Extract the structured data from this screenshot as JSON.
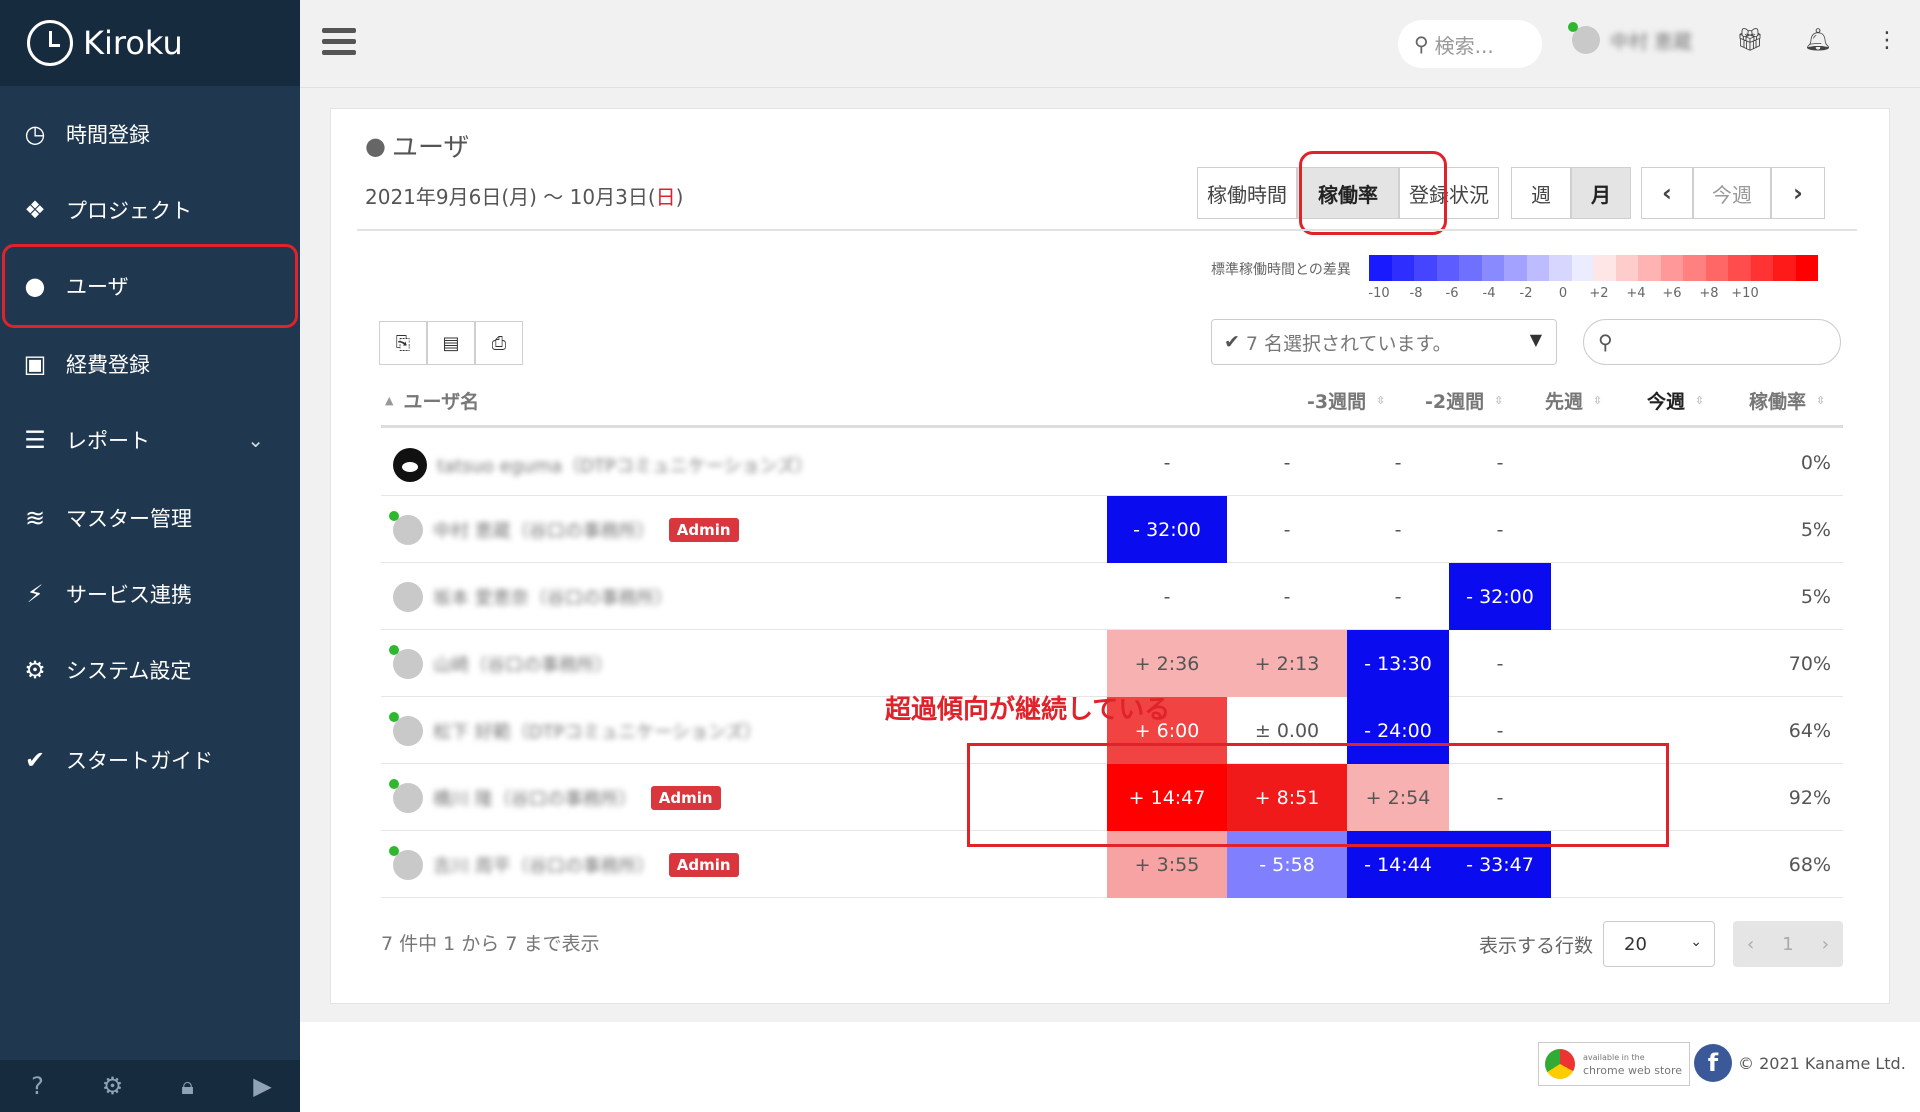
{
  "app": {
    "name": "Kiroku"
  },
  "sidebar": {
    "items": [
      {
        "label": "時間登録",
        "icon": "clock-icon"
      },
      {
        "label": "プロジェクト",
        "icon": "cubes-icon"
      },
      {
        "label": "ユーザ",
        "icon": "user-icon",
        "active": true
      },
      {
        "label": "経費登録",
        "icon": "train-icon"
      },
      {
        "label": "レポート",
        "icon": "list-icon",
        "has_submenu": true
      },
      {
        "label": "マスター管理",
        "icon": "database-icon"
      },
      {
        "label": "サービス連携",
        "icon": "plug-icon"
      },
      {
        "label": "システム設定",
        "icon": "gear-icon"
      },
      {
        "label": "スタートガイド",
        "icon": "check-icon"
      }
    ],
    "footer_icons": [
      "help-icon",
      "gear-icon",
      "lock-icon",
      "play-icon"
    ]
  },
  "topbar": {
    "search_placeholder": "検索...",
    "user_name": "中村 恵蔵"
  },
  "page": {
    "title": "ユーザ",
    "date_range_prefix": "2021年9月6日(月) ～ 10月3日(",
    "date_range_sun": "日",
    "date_range_suffix": ")",
    "view_tabs": [
      "稼働時間",
      "稼働率",
      "登録状況"
    ],
    "active_view": "稼働率",
    "period_tabs": [
      "週",
      "月"
    ],
    "active_period": "月",
    "this_week": "今週"
  },
  "legend": {
    "label": "標準稼働時間との差異",
    "ticks": [
      "-10",
      "-8",
      "-6",
      "-4",
      "-2",
      "0",
      "+2",
      "+4",
      "+6",
      "+8",
      "+10"
    ],
    "blue_scale": [
      "#1a1aff",
      "#2e2eff",
      "#4545ff",
      "#5c5cff",
      "#7070ff",
      "#8a8aff",
      "#a3a3ff",
      "#bcbcff",
      "#d6d6ff",
      "#ececff"
    ],
    "red_scale": [
      "#ffe6e6",
      "#ffcccc",
      "#ffb3b3",
      "#ff9999",
      "#ff8080",
      "#ff6666",
      "#ff4d4d",
      "#ff3333",
      "#ff1a1a",
      "#ff0000"
    ]
  },
  "filter": {
    "selected_text": "7 名選択されています。"
  },
  "table": {
    "headers": {
      "user": "ユーザ名",
      "w3": "-3週間",
      "w2": "-2週間",
      "w1": "先週",
      "w0": "今週",
      "rate": "稼働率"
    },
    "rows": [
      {
        "name": "tatsuo eguma（DTPコミュニケーションズ）",
        "admin": false,
        "online": false,
        "kumamon": true,
        "w3": "-",
        "w2": "-",
        "w1": "-",
        "w0": "-",
        "rate": "0%",
        "c3": "",
        "c2": "",
        "c1": "",
        "c0": ""
      },
      {
        "name": "中村 恵蔵（谷口の事務所）",
        "admin": true,
        "online": true,
        "w3": "- 32:00",
        "w2": "-",
        "w1": "-",
        "w0": "-",
        "rate": "5%",
        "c3": "#0b0bf0",
        "c2": "",
        "c1": "",
        "c0": ""
      },
      {
        "name": "坂本 愛恵奈（谷口の事務所）",
        "admin": false,
        "online": false,
        "w3": "-",
        "w2": "-",
        "w1": "-",
        "w0": "- 32:00",
        "rate": "5%",
        "c3": "",
        "c2": "",
        "c1": "",
        "c0": "#0b0bf0"
      },
      {
        "name": "山崎（谷口の事務所）",
        "admin": false,
        "online": true,
        "w3": "+ 2:36",
        "w2": "+ 2:13",
        "w1": "- 13:30",
        "w0": "-",
        "rate": "70%",
        "c3": "#f7b1b1",
        "c2": "#f7b1b1",
        "c1": "#0b0bf0",
        "c0": ""
      },
      {
        "name": "松下 好範（DTPコミュニケーションズ）",
        "admin": false,
        "online": true,
        "w3": "+ 6:00",
        "w2": "± 0.00",
        "w1": "- 24:00",
        "w0": "-",
        "rate": "64%",
        "c3": "#f24343",
        "c2": "",
        "c1": "#0b0bf0",
        "c0": ""
      },
      {
        "name": "橋川 隆（谷口の事務所）",
        "admin": true,
        "online": true,
        "w3": "+ 14:47",
        "w2": "+ 8:51",
        "w1": "+ 2:54",
        "w0": "-",
        "rate": "92%",
        "c3": "#ff0000",
        "c2": "#f01a1a",
        "c1": "#f7b1b1",
        "c0": ""
      },
      {
        "name": "吉川 周平（谷口の事務所）",
        "admin": true,
        "online": true,
        "w3": "+ 3:55",
        "w2": "- 5:58",
        "w1": "- 14:44",
        "w0": "- 33:47",
        "rate": "68%",
        "c3": "#f7a3a3",
        "c2": "#8080ff",
        "c1": "#0b0bf0",
        "c0": "#0b0bf0"
      }
    ],
    "admin_label": "Admin"
  },
  "annotation": {
    "text": "超過傾向が継続している"
  },
  "pagination": {
    "info": "7 件中 1 から 7 まで表示",
    "rows_label": "表示する行数",
    "rows_value": "20",
    "page": "1"
  },
  "footer": {
    "store_line1": "available in the",
    "store_line2": "chrome web store",
    "copyright": "© 2021 Kaname Ltd."
  }
}
